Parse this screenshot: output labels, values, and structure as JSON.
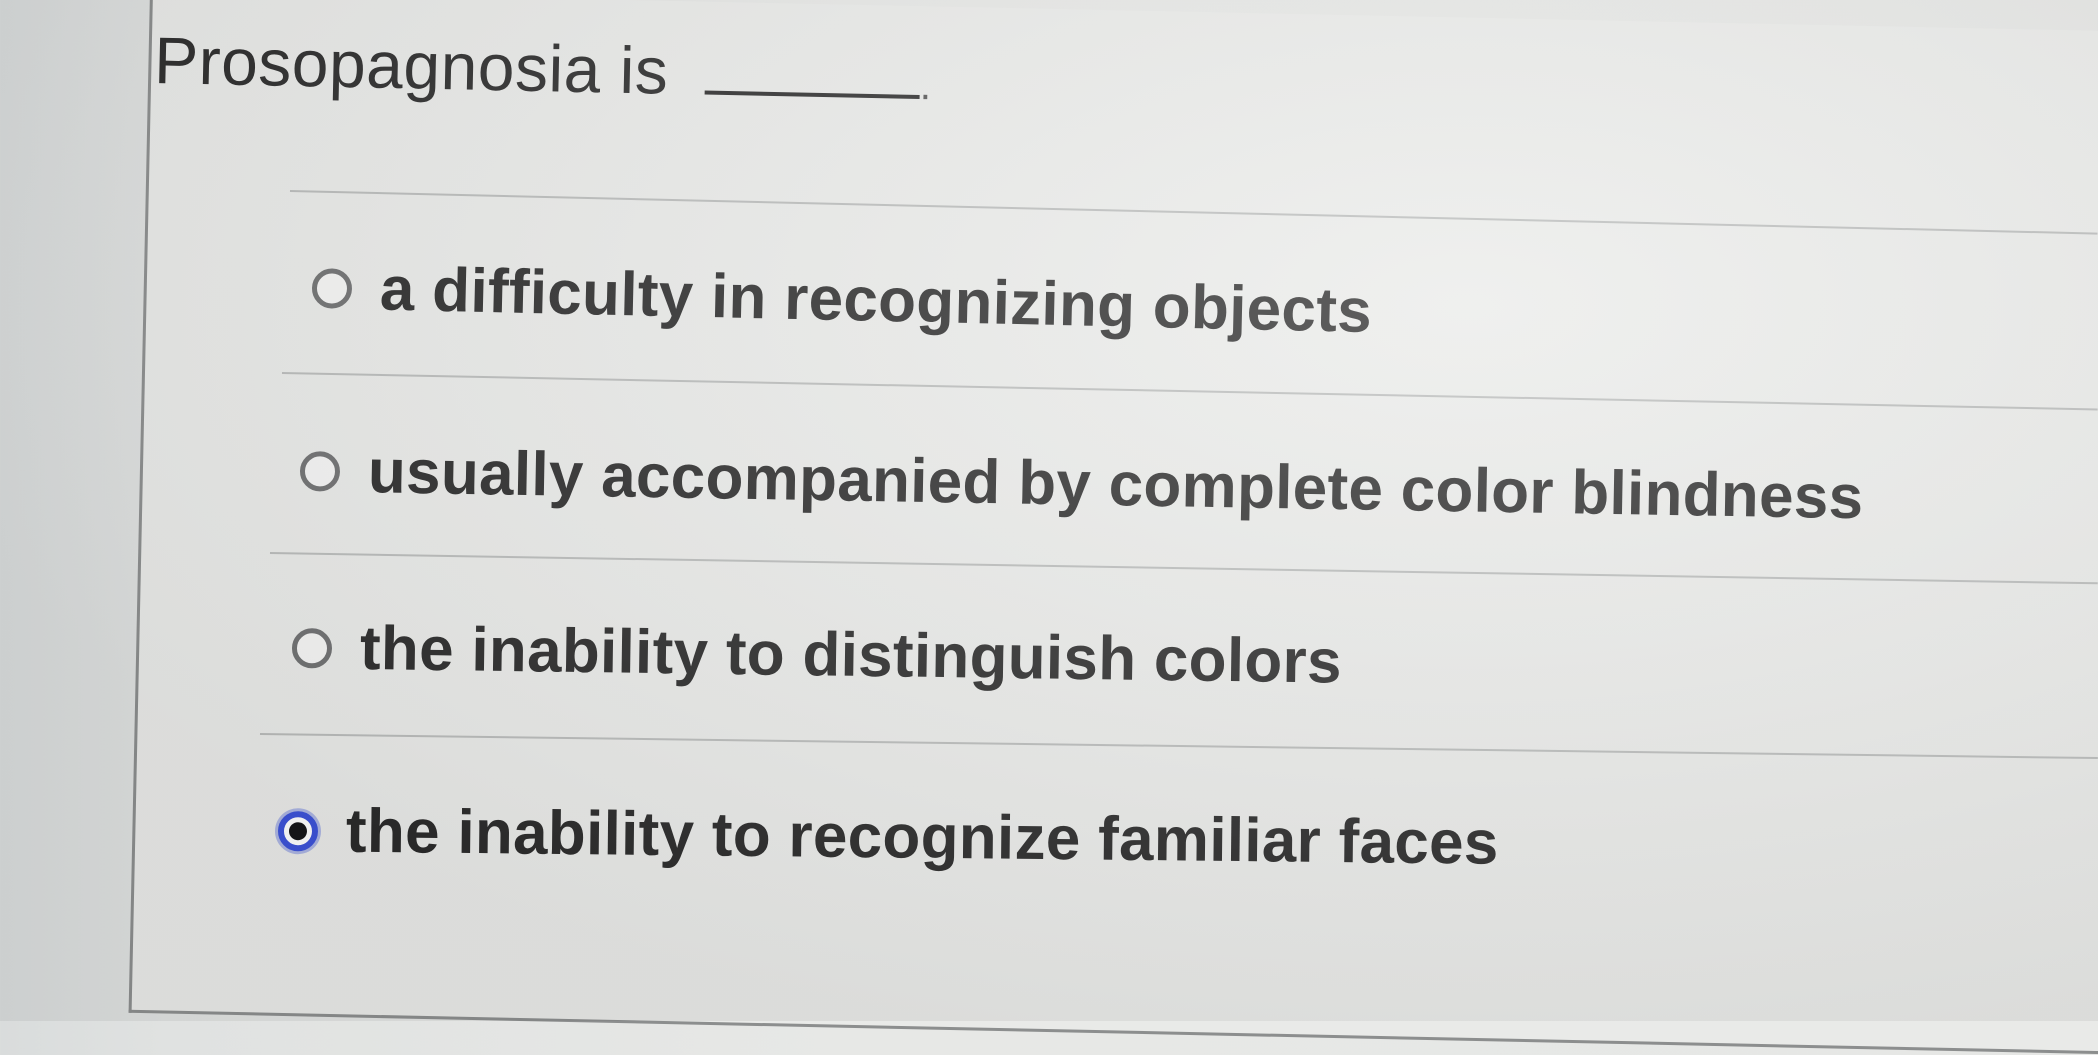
{
  "question": {
    "text": "Prosopagnosia is",
    "blank": "______",
    "period": "."
  },
  "options": [
    {
      "label": "a difficulty in recognizing objects",
      "selected": false
    },
    {
      "label": "usually accompanied by complete color blindness",
      "selected": false
    },
    {
      "label": "the inability to distinguish colors",
      "selected": false
    },
    {
      "label": "the inability to recognize familiar faces",
      "selected": true
    }
  ],
  "colors": {
    "selected_radio": "#3d53d8",
    "text": "#2a2a2a"
  }
}
